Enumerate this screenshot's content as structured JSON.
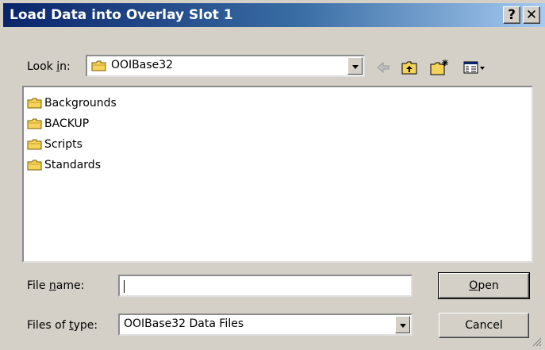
{
  "window": {
    "title": "Load Data into Overlay Slot 1",
    "help_label": "?",
    "close_label": "✕"
  },
  "lookin": {
    "label_pre": "Look ",
    "label_u": "i",
    "label_post": "n:",
    "value": "OOIBase32"
  },
  "files": [
    {
      "name": "Backgrounds",
      "icon": "folder-icon"
    },
    {
      "name": "BACKUP",
      "icon": "folder-icon"
    },
    {
      "name": "Scripts",
      "icon": "folder-icon"
    },
    {
      "name": "Standards",
      "icon": "folder-icon"
    }
  ],
  "filename": {
    "label_pre": "File ",
    "label_u": "n",
    "label_post": "ame:",
    "value": ""
  },
  "filetype": {
    "label_pre": "Files of ",
    "label_u": "t",
    "label_post": "ype:",
    "value": "OOIBase32 Data Files"
  },
  "buttons": {
    "open_u": "O",
    "open_rest": "pen",
    "cancel": "Cancel"
  },
  "toolbar": {
    "back_icon": "back-arrow-icon",
    "up_icon": "up-folder-icon",
    "new_folder_icon": "new-folder-icon",
    "view_icon": "view-menu-icon"
  },
  "colors": {
    "title_start": "#0a246a",
    "title_end": "#a6caf0",
    "face": "#d4d0c8",
    "folder": "#f5d35a"
  }
}
